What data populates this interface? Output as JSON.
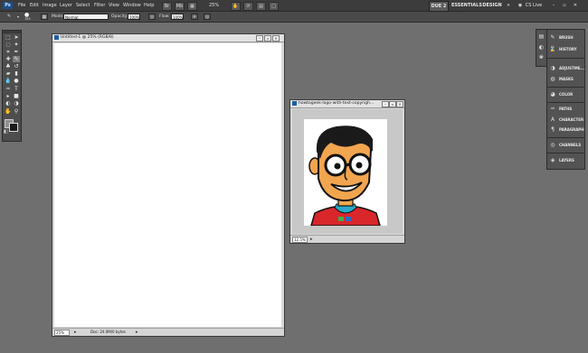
{
  "menubar": {
    "logo": "Ps",
    "menus": [
      "File",
      "Edit",
      "Image",
      "Layer",
      "Select",
      "Filter",
      "View",
      "Window",
      "Help"
    ],
    "zoom": "25%",
    "workspaces": [
      "DUE 2",
      "ESSENTIALS",
      "DESIGN"
    ],
    "more": "»",
    "cs_live": "CS Live"
  },
  "options": {
    "brush_size": "155",
    "mode_label": "Mode:",
    "mode_value": "Normal",
    "opacity_label": "Opacity:",
    "opacity_value": "100%",
    "flow_label": "Flow:",
    "flow_value": "100%"
  },
  "documents": [
    {
      "title": "Untitled-1 @ 25% (RGB/8)",
      "zoom": "25%",
      "status": "Doc: 24.0M/0 bytes"
    },
    {
      "title": "howtogeek-logo-with-text-copyrigh...",
      "zoom": "12.5%"
    }
  ],
  "dock": {
    "panels": [
      "BRUSH",
      "HISTORY",
      "ADJUSTME...",
      "MASKS",
      "COLOR",
      "PATHS",
      "CHARACTER",
      "PARAGRAPH",
      "CHANNELS",
      "LAYERS"
    ]
  }
}
